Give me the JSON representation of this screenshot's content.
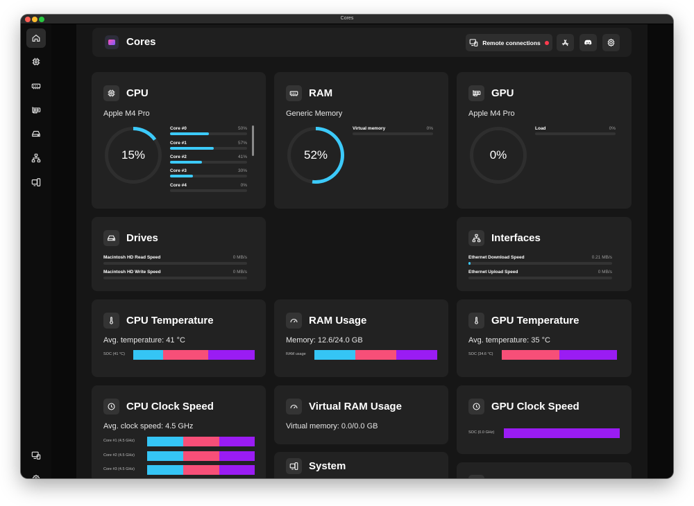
{
  "window": {
    "title": "Cores"
  },
  "header": {
    "app_title": "Cores",
    "remote_label": "Remote connections"
  },
  "colors": {
    "accent": "#3ccafa",
    "bar_cyan": "#35c5f5",
    "bar_pink": "#f74f78",
    "bar_purple": "#9a1cf3",
    "status_red": "#ff3b4e"
  },
  "cpu": {
    "title": "CPU",
    "model": "Apple M4 Pro",
    "usage_label": "15%",
    "usage_fraction": 0.15,
    "cores": [
      {
        "name": "Core #0",
        "value": "50%",
        "fraction": 0.5
      },
      {
        "name": "Core #1",
        "value": "57%",
        "fraction": 0.57
      },
      {
        "name": "Core #2",
        "value": "41%",
        "fraction": 0.41
      },
      {
        "name": "Core #3",
        "value": "30%",
        "fraction": 0.3
      },
      {
        "name": "Core #4",
        "value": "0%",
        "fraction": 0.0
      }
    ]
  },
  "ram": {
    "title": "RAM",
    "model": "Generic Memory",
    "usage_label": "52%",
    "usage_fraction": 0.52,
    "virtual_label": "Virtual memory",
    "virtual_value": "0%",
    "virtual_fraction": 0.0
  },
  "gpu": {
    "title": "GPU",
    "model": "Apple M4 Pro",
    "usage_label": "0%",
    "usage_fraction": 0.0,
    "load_label": "Load",
    "load_value": "0%",
    "load_fraction": 0.0
  },
  "drives": {
    "title": "Drives",
    "rows": [
      {
        "name": "Macintosh HD Read Speed",
        "value": "0 MB/s",
        "fraction": 0.0
      },
      {
        "name": "Macintosh HD Write Speed",
        "value": "0 MB/s",
        "fraction": 0.0
      }
    ]
  },
  "interfaces": {
    "title": "Interfaces",
    "rows": [
      {
        "name": "Ethernet Download Speed",
        "value": "0.21 MB/s",
        "fraction": 0.01
      },
      {
        "name": "Ethernet Upload Speed",
        "value": "0 MB/s",
        "fraction": 0.0
      }
    ]
  },
  "cpu_temp": {
    "title": "CPU Temperature",
    "subtitle": "Avg. temperature: 41 °C",
    "row_label": "SOC (41 °C)"
  },
  "ram_usage": {
    "title": "RAM Usage",
    "subtitle": "Memory: 12.6/24.0 GB",
    "row_label": "RAM usage"
  },
  "gpu_temp": {
    "title": "GPU Temperature",
    "subtitle": "Avg. temperature: 35 °C",
    "row_label": "SOC (34.6 °C)"
  },
  "cpu_clock": {
    "title": "CPU Clock Speed",
    "subtitle": "Avg. clock speed: 4.5 GHz",
    "rows": [
      "Core #1 (4.5 GHz)",
      "Core #2 (4.5 GHz)",
      "Core #3 (4.5 GHz)"
    ]
  },
  "vram": {
    "title": "Virtual RAM Usage",
    "subtitle": "Virtual memory: 0.0/0.0 GB"
  },
  "gpu_clock": {
    "title": "GPU Clock Speed",
    "row_label": "SOC (0.0 GHz)"
  },
  "system": {
    "title": "System"
  }
}
